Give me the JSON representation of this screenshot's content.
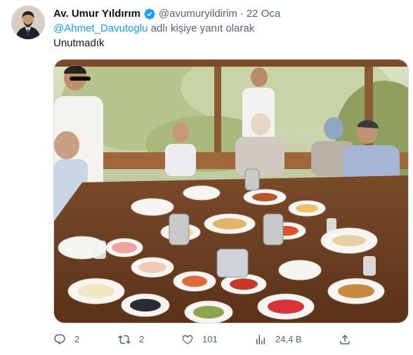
{
  "author": {
    "name": "Av. Umur Yıldırım",
    "handle": "@avumuryildirim",
    "separator": "·",
    "time": "22 Oca"
  },
  "reply": {
    "mention": "@Ahmet_Davutoglu",
    "suffix": " adlı kişiye yanıt olarak"
  },
  "tweet": {
    "text": "Unutmadık"
  },
  "actions": {
    "replies": "2",
    "retweets": "2",
    "likes": "101",
    "views": "24,4 B"
  },
  "colors": {
    "text": "#0f1419",
    "secondary": "#536471",
    "accent": "#1d9bf0"
  }
}
